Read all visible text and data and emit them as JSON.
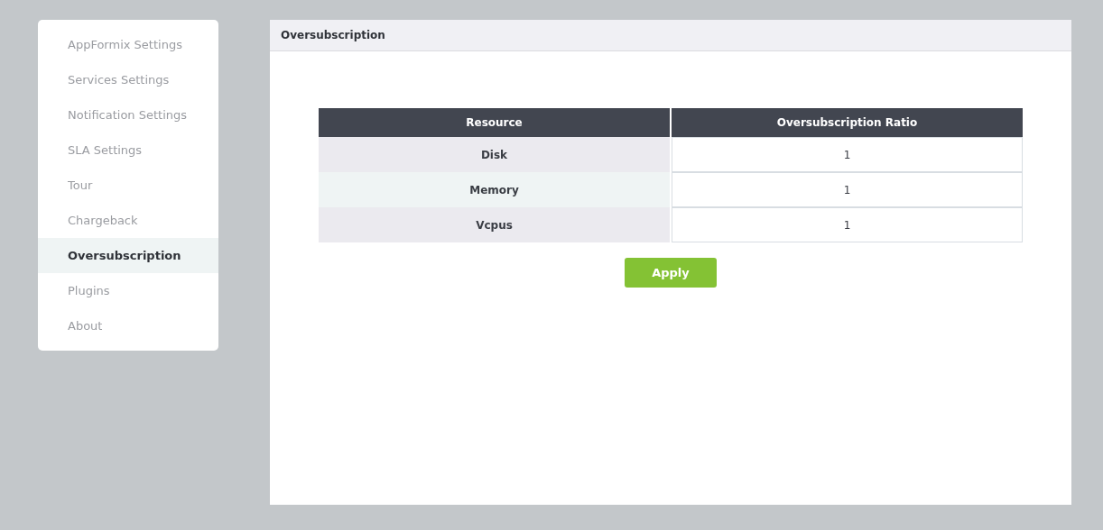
{
  "sidebar": {
    "items": [
      {
        "label": "AppFormix Settings",
        "selected": false
      },
      {
        "label": "Services Settings",
        "selected": false
      },
      {
        "label": "Notification Settings",
        "selected": false
      },
      {
        "label": "SLA Settings",
        "selected": false
      },
      {
        "label": "Tour",
        "selected": false
      },
      {
        "label": "Chargeback",
        "selected": false
      },
      {
        "label": "Oversubscription",
        "selected": true
      },
      {
        "label": "Plugins",
        "selected": false
      },
      {
        "label": "About",
        "selected": false
      }
    ]
  },
  "panel": {
    "title": "Oversubscription",
    "table": {
      "columns": [
        "Resource",
        "Oversubscription Ratio"
      ],
      "rows": [
        {
          "resource": "Disk",
          "ratio": "1"
        },
        {
          "resource": "Memory",
          "ratio": "1"
        },
        {
          "resource": "Vcpus",
          "ratio": "1"
        }
      ]
    },
    "button": "Apply"
  }
}
